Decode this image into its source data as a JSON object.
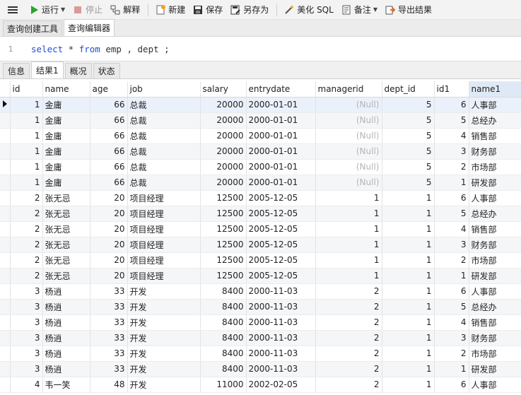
{
  "toolbar": {
    "run": "运行",
    "stop": "停止",
    "explain": "解释",
    "new": "新建",
    "save": "保存",
    "save_as": "另存为",
    "beautify": "美化 SQL",
    "note": "备注",
    "export": "导出结果"
  },
  "tabs": [
    "查询创建工具",
    "查询编辑器"
  ],
  "editor": {
    "line_number": "1",
    "kw_select": "select",
    "star": " * ",
    "kw_from": "from",
    "rest": " emp , dept ;"
  },
  "result_tabs": [
    "信息",
    "结果1",
    "概况",
    "状态"
  ],
  "columns": [
    "id",
    "name",
    "age",
    "job",
    "salary",
    "entrydate",
    "managerid",
    "dept_id",
    "id1",
    "name1"
  ],
  "rows": [
    [
      "1",
      "金庸",
      "66",
      "总裁",
      "20000",
      "2000-01-01",
      "(Null)",
      "5",
      "6",
      "人事部"
    ],
    [
      "1",
      "金庸",
      "66",
      "总裁",
      "20000",
      "2000-01-01",
      "(Null)",
      "5",
      "5",
      "总经办"
    ],
    [
      "1",
      "金庸",
      "66",
      "总裁",
      "20000",
      "2000-01-01",
      "(Null)",
      "5",
      "4",
      "销售部"
    ],
    [
      "1",
      "金庸",
      "66",
      "总裁",
      "20000",
      "2000-01-01",
      "(Null)",
      "5",
      "3",
      "财务部"
    ],
    [
      "1",
      "金庸",
      "66",
      "总裁",
      "20000",
      "2000-01-01",
      "(Null)",
      "5",
      "2",
      "市场部"
    ],
    [
      "1",
      "金庸",
      "66",
      "总裁",
      "20000",
      "2000-01-01",
      "(Null)",
      "5",
      "1",
      "研发部"
    ],
    [
      "2",
      "张无忌",
      "20",
      "项目经理",
      "12500",
      "2005-12-05",
      "1",
      "1",
      "6",
      "人事部"
    ],
    [
      "2",
      "张无忌",
      "20",
      "项目经理",
      "12500",
      "2005-12-05",
      "1",
      "1",
      "5",
      "总经办"
    ],
    [
      "2",
      "张无忌",
      "20",
      "项目经理",
      "12500",
      "2005-12-05",
      "1",
      "1",
      "4",
      "销售部"
    ],
    [
      "2",
      "张无忌",
      "20",
      "项目经理",
      "12500",
      "2005-12-05",
      "1",
      "1",
      "3",
      "财务部"
    ],
    [
      "2",
      "张无忌",
      "20",
      "项目经理",
      "12500",
      "2005-12-05",
      "1",
      "1",
      "2",
      "市场部"
    ],
    [
      "2",
      "张无忌",
      "20",
      "项目经理",
      "12500",
      "2005-12-05",
      "1",
      "1",
      "1",
      "研发部"
    ],
    [
      "3",
      "杨逍",
      "33",
      "开发",
      "8400",
      "2000-11-03",
      "2",
      "1",
      "6",
      "人事部"
    ],
    [
      "3",
      "杨逍",
      "33",
      "开发",
      "8400",
      "2000-11-03",
      "2",
      "1",
      "5",
      "总经办"
    ],
    [
      "3",
      "杨逍",
      "33",
      "开发",
      "8400",
      "2000-11-03",
      "2",
      "1",
      "4",
      "销售部"
    ],
    [
      "3",
      "杨逍",
      "33",
      "开发",
      "8400",
      "2000-11-03",
      "2",
      "1",
      "3",
      "财务部"
    ],
    [
      "3",
      "杨逍",
      "33",
      "开发",
      "8400",
      "2000-11-03",
      "2",
      "1",
      "2",
      "市场部"
    ],
    [
      "3",
      "杨逍",
      "33",
      "开发",
      "8400",
      "2000-11-03",
      "2",
      "1",
      "1",
      "研发部"
    ],
    [
      "4",
      "韦一笑",
      "48",
      "开发",
      "11000",
      "2002-02-05",
      "2",
      "1",
      "6",
      "人事部"
    ]
  ]
}
